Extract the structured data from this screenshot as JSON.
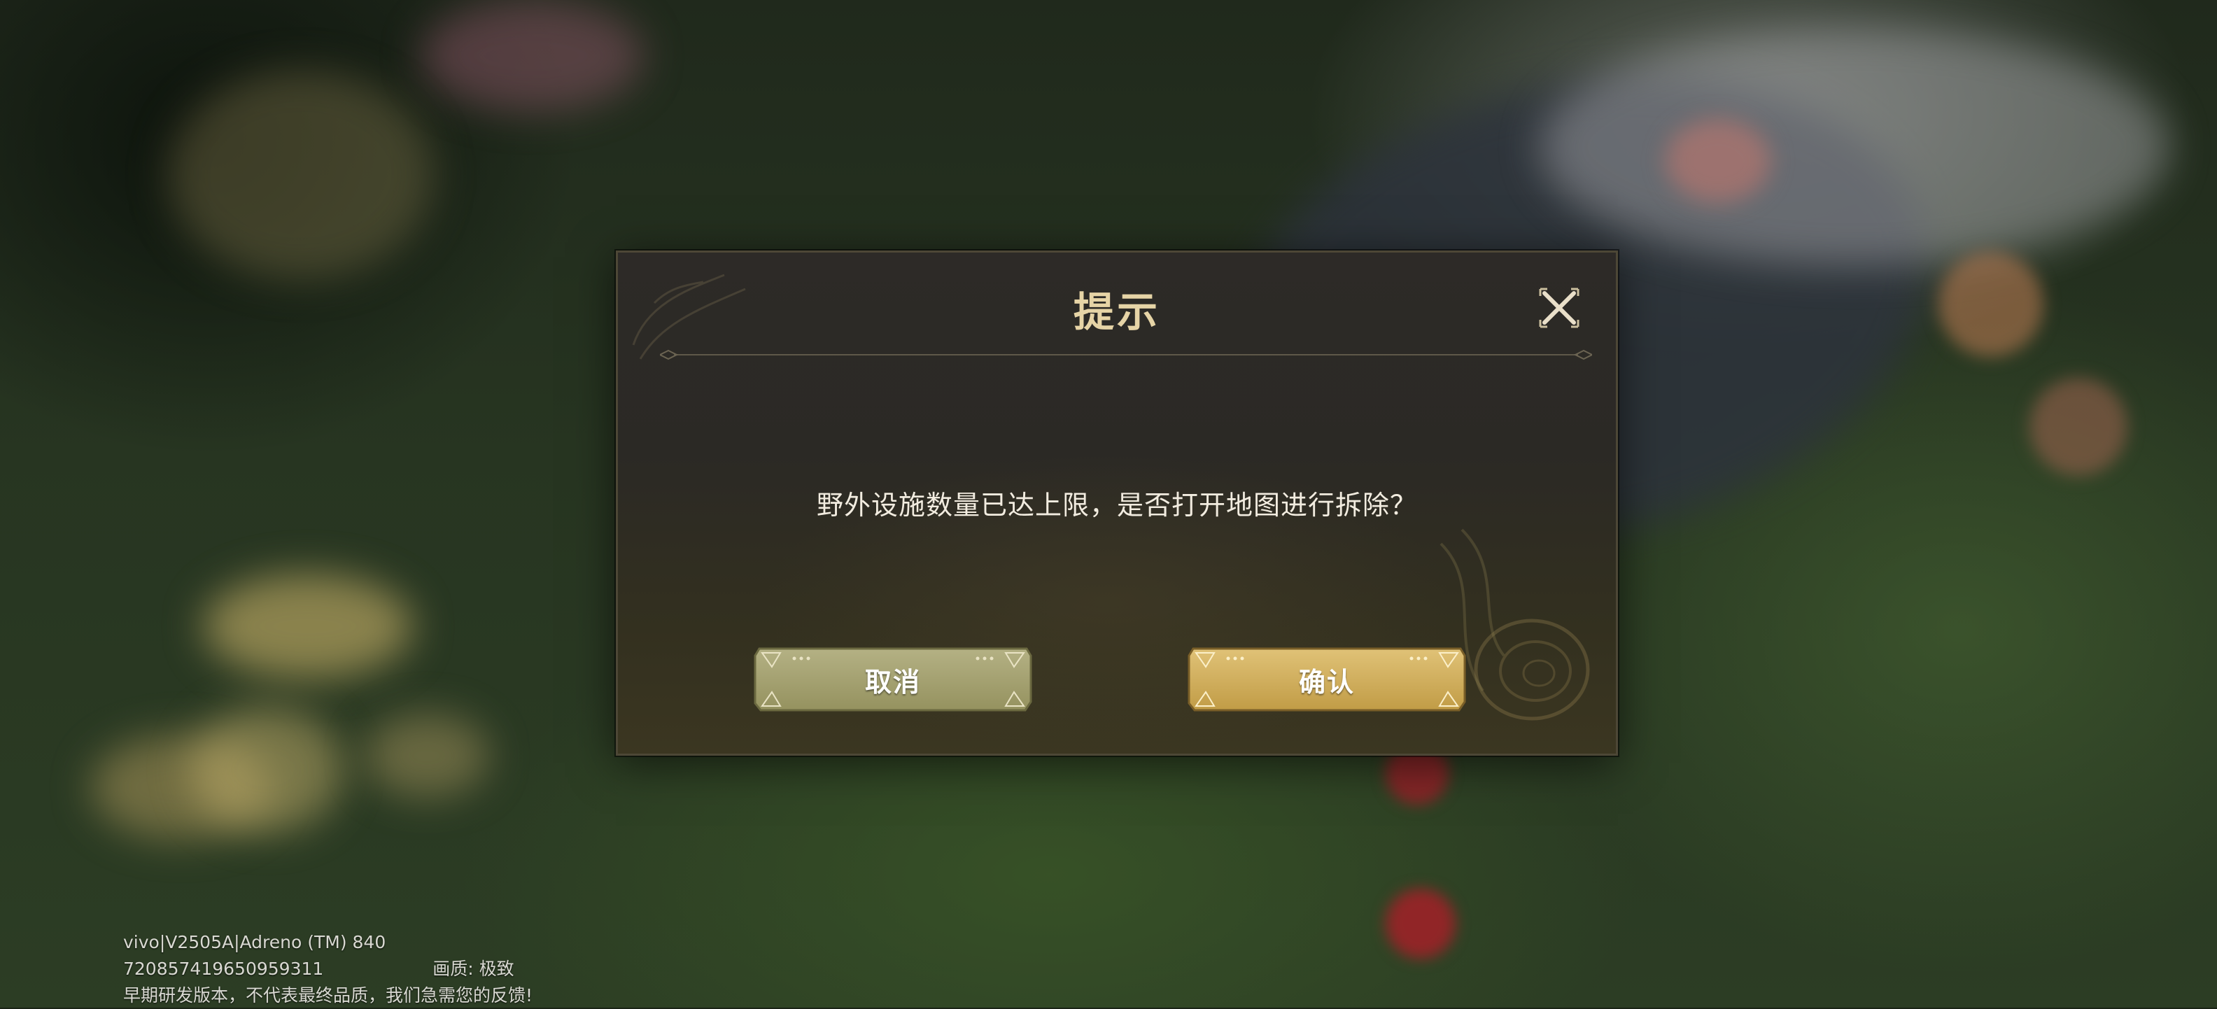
{
  "dialog": {
    "title": "提示",
    "message": "野外设施数量已达上限，是否打开地图进行拆除？",
    "cancel_label": "取消",
    "confirm_label": "确认"
  },
  "debug": {
    "device": "vivo|V2505A|Adreno (TM) 840",
    "id": "720857419650959311",
    "quality": "画质: 极致",
    "notice": "早期研发版本，不代表最终品质，我们急需您的反馈!"
  },
  "colors": {
    "title": "#e6d4a6",
    "cancel_button": "#a9a67a",
    "confirm_button": "#d3b25e",
    "dialog_bg": "#2d2a27"
  },
  "icons": {
    "close": "close-icon"
  }
}
